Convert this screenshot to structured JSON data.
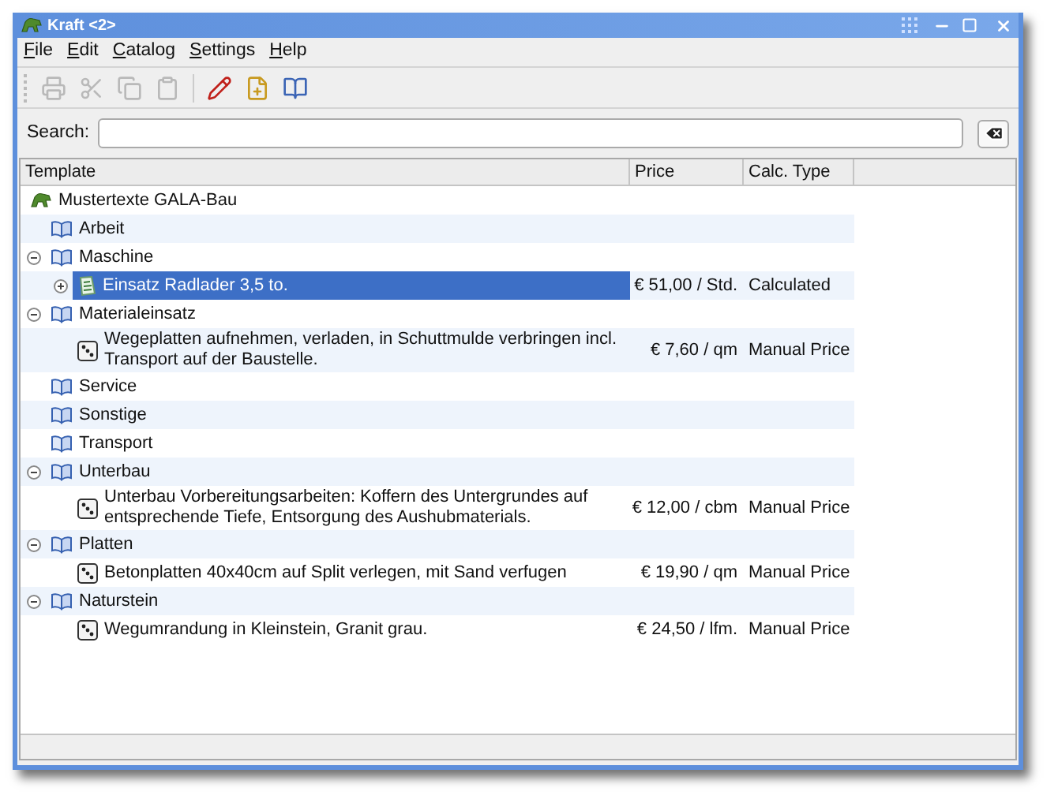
{
  "window": {
    "title": "Kraft <2>"
  },
  "menu": [
    {
      "label": "File"
    },
    {
      "label": "Edit"
    },
    {
      "label": "Catalog"
    },
    {
      "label": "Settings"
    },
    {
      "label": "Help"
    }
  ],
  "toolbar": [
    {
      "kind": "print",
      "disabled": true
    },
    {
      "kind": "cut",
      "disabled": true
    },
    {
      "kind": "copy",
      "disabled": true
    },
    {
      "kind": "paste",
      "disabled": true
    },
    {
      "kind": "separator"
    },
    {
      "kind": "edit",
      "disabled": false
    },
    {
      "kind": "new",
      "disabled": false
    },
    {
      "kind": "catalog",
      "disabled": false
    }
  ],
  "search": {
    "label": "Search:"
  },
  "table": {
    "columns": [
      "Template",
      "Price",
      "Calc. Type"
    ],
    "tree": [
      {
        "kind": "root",
        "text": "Mustertexte GALA-Bau",
        "children": [
          {
            "kind": "category",
            "text": "Arbeit"
          },
          {
            "kind": "category",
            "text": "Maschine",
            "expanded": true,
            "children": [
              {
                "kind": "calculated",
                "text": "Einsatz Radlader 3,5 to.",
                "price": "€ 51,00 / Std.",
                "calc_type": "Calculated",
                "selected": true,
                "expanded": false
              }
            ]
          },
          {
            "kind": "category",
            "text": "Materialeinsatz",
            "expanded": true,
            "children": [
              {
                "kind": "template",
                "text": "Wegeplatten aufnehmen, verladen, in Schuttmulde verbringen incl. Transport auf der Baustelle.",
                "price": "€ 7,60 / qm",
                "calc_type": "Manual Price",
                "selected": false
              }
            ]
          },
          {
            "kind": "category",
            "text": "Service"
          },
          {
            "kind": "category",
            "text": "Sonstige"
          },
          {
            "kind": "category",
            "text": "Transport"
          },
          {
            "kind": "category",
            "text": "Unterbau",
            "expanded": true,
            "children": [
              {
                "kind": "template",
                "text": "Unterbau Vorbereitungsarbeiten: Koffern des Untergrundes auf entsprechende Tiefe, Entsorgung des Aushubmaterials.",
                "price": "€ 12,00 / cbm",
                "calc_type": "Manual Price",
                "selected": false
              }
            ]
          },
          {
            "kind": "category",
            "text": "Platten",
            "expanded": true,
            "children": [
              {
                "kind": "template",
                "text": "Betonplatten 40x40cm auf Split verlegen, mit Sand verfugen",
                "price": "€ 19,90 / qm",
                "calc_type": "Manual Price",
                "selected": false
              }
            ]
          },
          {
            "kind": "category",
            "text": "Naturstein",
            "expanded": true,
            "children": [
              {
                "kind": "template",
                "text": "Wegumrandung in Kleinstein, Granit grau.",
                "price": "€ 24,50 / lfm.",
                "calc_type": "Manual Price",
                "selected": false
              }
            ]
          }
        ]
      }
    ]
  }
}
